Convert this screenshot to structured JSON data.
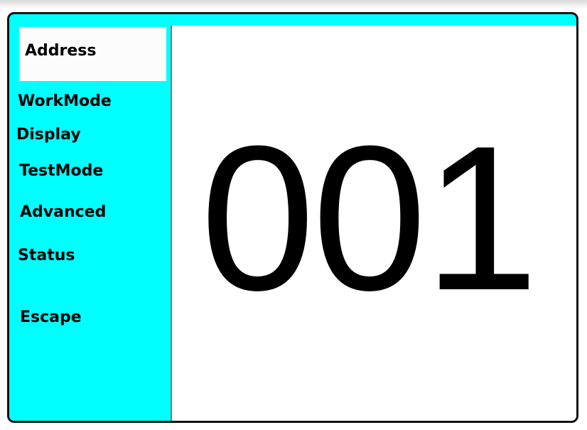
{
  "menu": {
    "items": [
      {
        "label": "Address",
        "selected": true
      },
      {
        "label": "WorkMode",
        "selected": false
      },
      {
        "label": "Display",
        "selected": false
      },
      {
        "label": "TestMode",
        "selected": false
      },
      {
        "label": "Advanced",
        "selected": false
      },
      {
        "label": "Status",
        "selected": false
      },
      {
        "label": "Escape",
        "selected": false
      }
    ]
  },
  "panel": {
    "value": "001"
  },
  "colors": {
    "background": "#00ffff",
    "selected_item": "#fcfcfc",
    "panel": "#ffffff",
    "text": "#000000"
  }
}
